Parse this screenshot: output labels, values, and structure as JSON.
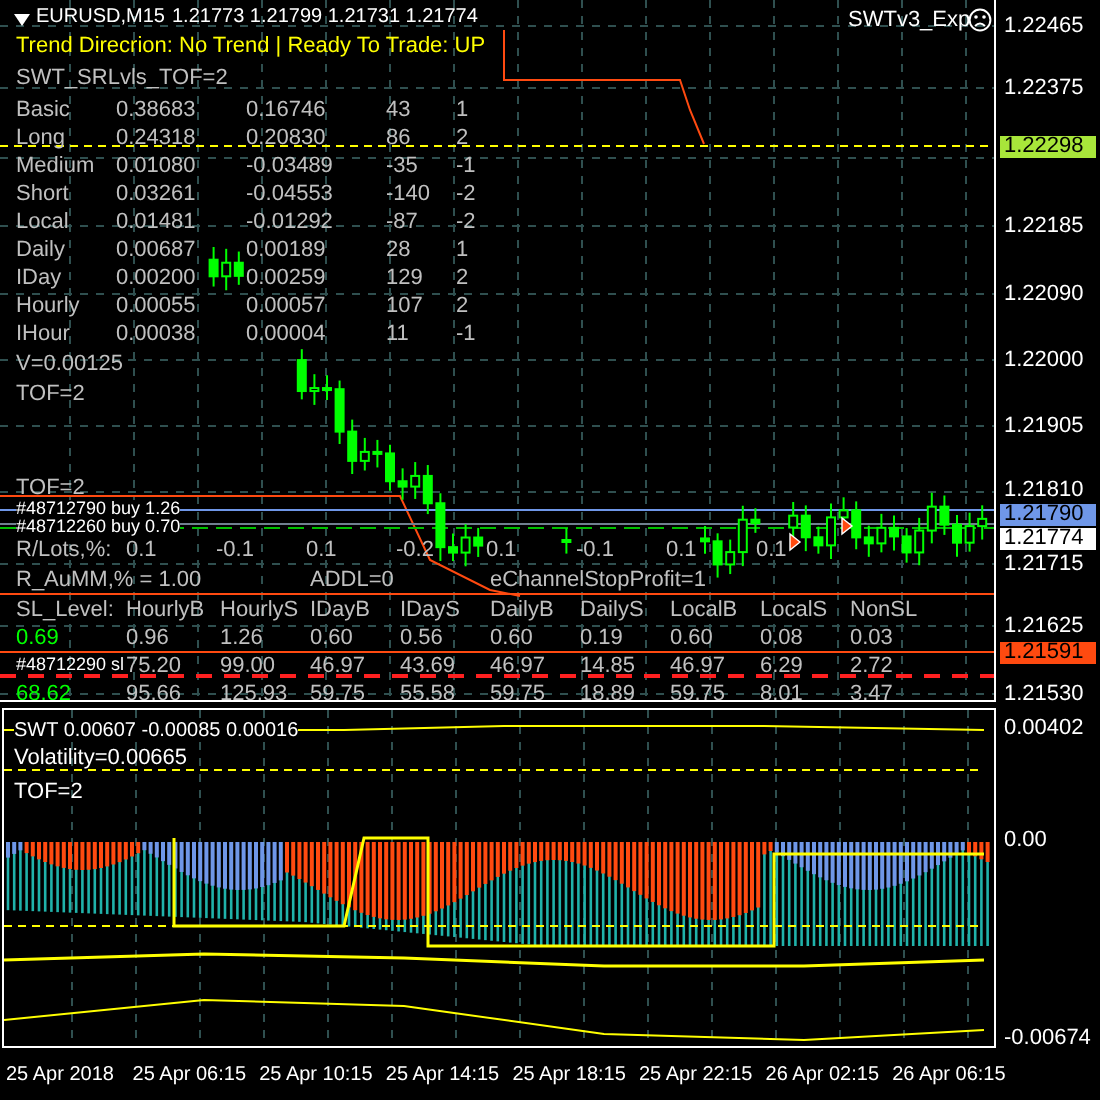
{
  "header": {
    "symbol": "EURUSD,M15",
    "ohlc": "1.21773 1.21799 1.21731 1.21774"
  },
  "expert": {
    "name": "SWTv3_Exp"
  },
  "trend": "Trend Direcrion:  No Trend  |  Ready To Trade:  UP",
  "levels_title": "SWT_SRLvls_TOF=2",
  "levels": [
    {
      "cells": [
        "Basic",
        "0.38683",
        "0.16746",
        "43",
        "1"
      ]
    },
    {
      "cells": [
        "Long",
        "0.24318",
        "0.20830",
        "86",
        "2"
      ]
    },
    {
      "cells": [
        "Medium",
        "0.01080",
        "-0.03489",
        "-35",
        "-1"
      ]
    },
    {
      "cells": [
        "Short",
        "0.03261",
        "-0.04553",
        "-140",
        "-2"
      ]
    },
    {
      "cells": [
        "Local",
        "0.01481",
        "-0.01292",
        "-87",
        "-2"
      ]
    },
    {
      "cells": [
        "Daily",
        "0.00687",
        "0.00189",
        "28",
        "1"
      ]
    },
    {
      "cells": [
        "IDay",
        "0.00200",
        "0.00259",
        "129",
        "2"
      ]
    },
    {
      "cells": [
        "Hourly",
        "0.00055",
        "0.00057",
        "107",
        "2"
      ]
    },
    {
      "cells": [
        "IHour",
        "0.00038",
        "0.00004",
        "11",
        "-1"
      ]
    }
  ],
  "v_text": "V=0.00125",
  "tof_texts": [
    "TOF=2",
    "TOF=2"
  ],
  "orders": [
    "#48712790 buy 1.26",
    "#48712260 buy 0.70"
  ],
  "lots": {
    "label": "R/Lots,%:",
    "values": [
      "0.1",
      "-0.1",
      "0.1",
      "-0.2",
      "0.1",
      "-0.1",
      "0.1",
      "0.1"
    ]
  },
  "aumm": "R_AuMM,% = 1.00",
  "addl": "ADDL=0",
  "channel": "eChannelStopProfit=1",
  "sl_table": {
    "headers": [
      "SL_Level:",
      "HourlyB",
      "HourlyS",
      "IDayB",
      "IDayS",
      "DailyB",
      "DailyS",
      "LocalB",
      "LocalS",
      "NonSL"
    ],
    "rows": [
      {
        "level": "0.69",
        "cells": [
          "0.96",
          "1.26",
          "0.60",
          "0.56",
          "0.60",
          "0.19",
          "0.60",
          "0.08",
          "0.03"
        ]
      },
      {
        "cells": [
          "75.20",
          "99.00",
          "46.97",
          "43.69",
          "46.97",
          "14.85",
          "46.97",
          "6.29",
          "2.72"
        ]
      },
      {
        "level": "68.62",
        "cells": [
          "95.66",
          "125.93",
          "59.75",
          "55.58",
          "59.75",
          "18.89",
          "59.75",
          "8.01",
          "3.47"
        ]
      }
    ],
    "sl_order": "#48712290 sl"
  },
  "price_axis": [
    {
      "text": "1.22465",
      "kind": "tick"
    },
    {
      "text": "1.22375",
      "kind": "tick"
    },
    {
      "text": "1.22298",
      "kind": "badge",
      "color": "#a8e63a"
    },
    {
      "text": "1.22185",
      "kind": "tick"
    },
    {
      "text": "1.22090",
      "kind": "tick"
    },
    {
      "text": "1.22000",
      "kind": "tick"
    },
    {
      "text": "1.21905",
      "kind": "tick"
    },
    {
      "text": "1.21810",
      "kind": "tick"
    },
    {
      "text": "1.21790",
      "kind": "badge",
      "color": "#6f97e8"
    },
    {
      "text": "1.21774",
      "kind": "badge",
      "color": "#ffffff"
    },
    {
      "text": "1.21715",
      "kind": "tick"
    },
    {
      "text": "1.21625",
      "kind": "tick"
    },
    {
      "text": "1.21591",
      "kind": "badge",
      "color": "#ff4a10"
    },
    {
      "text": "1.21530",
      "kind": "tick"
    }
  ],
  "indicator": {
    "title": "SWT  0.00607 -0.00085 0.00016",
    "volatility": "Volatility=0.00665",
    "tof": "TOF=2",
    "axis": [
      "0.00402",
      "0.00",
      "-0.00674"
    ]
  },
  "time_axis": [
    "25 Apr 2018",
    "25 Apr 06:15",
    "25 Apr 10:15",
    "25 Apr 14:15",
    "25 Apr 18:15",
    "25 Apr 22:15",
    "26 Apr 02:15",
    "26 Apr 06:15"
  ]
}
